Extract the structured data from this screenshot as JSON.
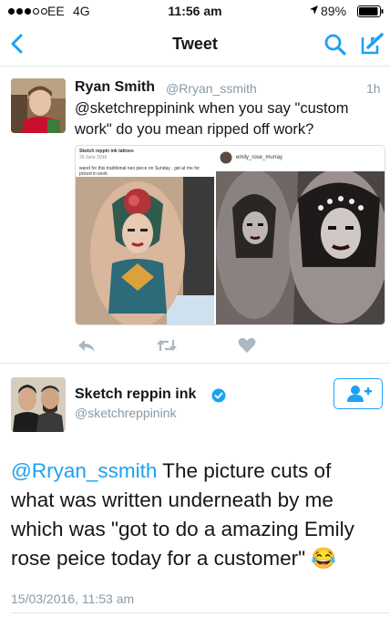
{
  "status_bar": {
    "carrier": "EE",
    "network": "4G",
    "time": "11:56 am",
    "battery": "89%"
  },
  "nav": {
    "back_icon": "chevron-left-icon",
    "title": "Tweet",
    "search_icon": "search-icon",
    "compose_icon": "compose-icon"
  },
  "tweet1": {
    "name": "Ryan Smith",
    "handle": "@Rryan_ssmith",
    "time": "1h",
    "text": "@sketchreppinink when you say \"custom work\" do you mean ripped off work?",
    "media": {
      "left_caption_title": "Sketch reppin ink tattoos",
      "left_caption_date": "20 June 2016",
      "left_caption_text": "wand for this traditional neo piece on Sunday , get at me for priced in work",
      "right_username": "emily_rose_murray"
    },
    "actions": [
      "reply-icon",
      "retweet-icon",
      "like-icon"
    ]
  },
  "tweet2": {
    "name": "Sketch reppin ink",
    "handle": "@sketchreppinink",
    "verified_icon": "verified-badge-icon",
    "follow_icon": "follow-user-icon",
    "mention": "@Rryan_ssmith",
    "text": " The picture cuts of what was written underneath by me which was \"got to do a amazing Emily rose peice today for a customer\" 😂",
    "timestamp": "15/03/2016, 11:53 am"
  },
  "colors": {
    "accent": "#1da1f2",
    "muted": "#8899a6",
    "divider": "#e1e8ed",
    "text": "#14171a"
  }
}
